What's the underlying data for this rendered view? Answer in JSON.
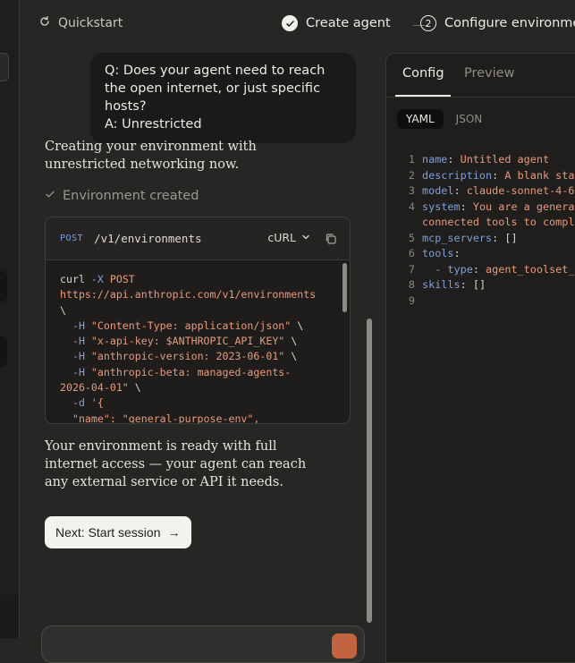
{
  "header": {
    "quickstart_label": "Quickstart",
    "steps": [
      {
        "label": "Create agent",
        "state": "done"
      },
      {
        "label": "Configure environmen",
        "number": "2",
        "state": "active"
      }
    ]
  },
  "chat": {
    "user_question": "Q: Does your agent need to reach the open internet, or just specific hosts?",
    "user_answer": "A: Unrestricted",
    "assistant_intro": "Creating your environment with unrestricted networking now.",
    "env_status": "Environment created",
    "api_call": {
      "method": "POST",
      "path": "/v1/environments",
      "language": "cURL",
      "code_lines": [
        "curl -X POST",
        "https://api.anthropic.com/v1/environments",
        "\\",
        "  -H \"Content-Type: application/json\" \\",
        "  -H \"x-api-key: $ANTHROPIC_API_KEY\" \\",
        "  -H \"anthropic-version: 2023-06-01\" \\",
        "  -H \"anthropic-beta: managed-agents-",
        "2026-04-01\" \\",
        "  -d '{",
        "  \"name\": \"general-purpose-env\","
      ]
    },
    "assistant_followup": "Your environment is ready with full internet access — your agent can reach any external service or API it needs.",
    "next_button_label": "Next: Start session",
    "next_button_arrow": "→"
  },
  "config_panel": {
    "tabs": [
      "Config",
      "Preview"
    ],
    "active_tab": "Config",
    "formats": [
      "YAML",
      "JSON"
    ],
    "active_format": "YAML",
    "yaml_lines": [
      {
        "n": "1",
        "key": "name",
        "value": "Untitled agent"
      },
      {
        "n": "2",
        "key": "description",
        "value": "A blank sta"
      },
      {
        "n": "3",
        "key": "model",
        "value": "claude-sonnet-4-6"
      },
      {
        "n": "4",
        "key": "system",
        "value": "You are a genera"
      },
      {
        "n": "",
        "key": "",
        "value": "connected tools to compl"
      },
      {
        "n": "5",
        "key": "mcp_servers",
        "value": "[]"
      },
      {
        "n": "6",
        "key": "tools",
        "value": ""
      },
      {
        "n": "7",
        "key": "  - type",
        "value": "agent_toolset_"
      },
      {
        "n": "8",
        "key": "skills",
        "value": "[]"
      },
      {
        "n": "9",
        "key": "",
        "value": ""
      }
    ]
  },
  "colors": {
    "background": "#262624",
    "accent_send": "#c4633f",
    "yaml_key": "#7fa0d8",
    "yaml_value": "#e89a7c"
  }
}
